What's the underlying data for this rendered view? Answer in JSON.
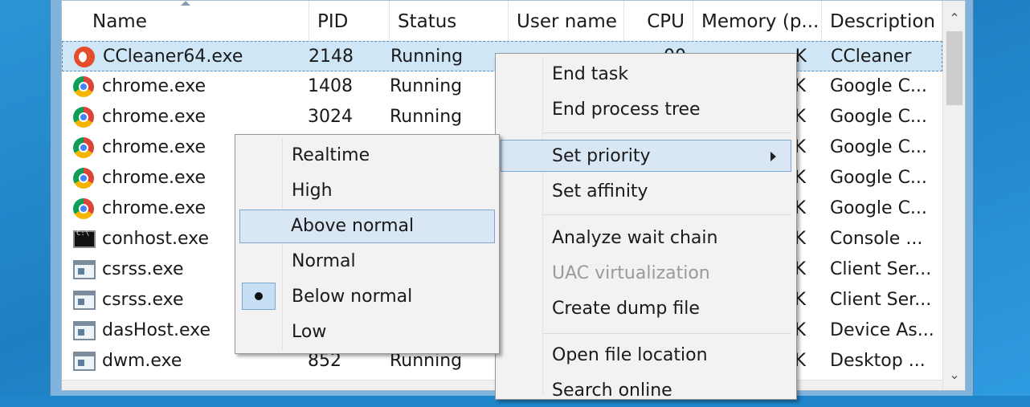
{
  "columns": {
    "name": "Name",
    "pid": "PID",
    "status": "Status",
    "user": "User name",
    "cpu": "CPU",
    "memory": "Memory (p...",
    "description": "Description"
  },
  "rows": [
    {
      "name": "CCleaner64.exe",
      "pid": "2148",
      "status": "Running",
      "user": "",
      "cpu": "00",
      "mem": "K",
      "desc": "CCleaner",
      "icon": "ccleaner-icon"
    },
    {
      "name": "chrome.exe",
      "pid": "1408",
      "status": "Running",
      "user": "",
      "cpu": "",
      "mem": "K",
      "desc": "Google C...",
      "icon": "chrome-icon"
    },
    {
      "name": "chrome.exe",
      "pid": "3024",
      "status": "Running",
      "user": "",
      "cpu": "",
      "mem": "K",
      "desc": "Google C...",
      "icon": "chrome-icon"
    },
    {
      "name": "chrome.exe",
      "pid": "",
      "status": "",
      "user": "",
      "cpu": "",
      "mem": "K",
      "desc": "Google C...",
      "icon": "chrome-icon"
    },
    {
      "name": "chrome.exe",
      "pid": "",
      "status": "",
      "user": "",
      "cpu": "",
      "mem": "K",
      "desc": "Google C...",
      "icon": "chrome-icon"
    },
    {
      "name": "chrome.exe",
      "pid": "",
      "status": "",
      "user": "",
      "cpu": "",
      "mem": "K",
      "desc": "Google C...",
      "icon": "chrome-icon"
    },
    {
      "name": "conhost.exe",
      "pid": "",
      "status": "",
      "user": "",
      "cpu": "",
      "mem": "K",
      "desc": "Console ...",
      "icon": "console-icon"
    },
    {
      "name": "csrss.exe",
      "pid": "",
      "status": "",
      "user": "",
      "cpu": "",
      "mem": "K",
      "desc": "Client Ser...",
      "icon": "window-icon"
    },
    {
      "name": "csrss.exe",
      "pid": "",
      "status": "",
      "user": "",
      "cpu": "",
      "mem": "K",
      "desc": "Client Ser...",
      "icon": "window-icon"
    },
    {
      "name": "dasHost.exe",
      "pid": "",
      "status": "",
      "user": "",
      "cpu": "",
      "mem": "K",
      "desc": "Device As...",
      "icon": "window-icon"
    },
    {
      "name": "dwm.exe",
      "pid": "852",
      "status": "Running",
      "user": "",
      "cpu": "",
      "mem": "K",
      "desc": "Desktop ...",
      "icon": "window-icon"
    }
  ],
  "context_menu": {
    "end_task": "End task",
    "end_process_tree": "End process tree",
    "set_priority": "Set priority",
    "set_affinity": "Set affinity",
    "analyze_wait_chain": "Analyze wait chain",
    "uac_virtualization": "UAC virtualization",
    "create_dump_file": "Create dump file",
    "open_file_location": "Open file location",
    "search_online": "Search online"
  },
  "priority_menu": {
    "realtime": "Realtime",
    "high": "High",
    "above_normal": "Above normal",
    "normal": "Normal",
    "below_normal": "Below normal",
    "low": "Low",
    "selected": "Below normal",
    "hovered": "Above normal"
  },
  "colors": {
    "selection": "#cfe6f7",
    "hover": "#d9e7f5",
    "accent_border": "#7ea6d2"
  }
}
